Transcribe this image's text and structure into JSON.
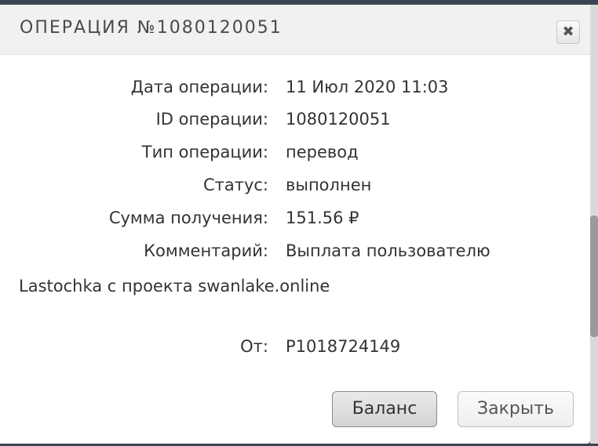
{
  "dialog": {
    "title": "ОПЕРАЦИЯ №1080120051",
    "close_icon": "✖"
  },
  "details": {
    "date_label": "Дата операции:",
    "date_value": "11 Июл 2020 11:03",
    "id_label": "ID операции:",
    "id_value": "1080120051",
    "type_label": "Тип операции:",
    "type_value": "перевод",
    "status_label": "Статус:",
    "status_value": "выполнен",
    "amount_label": "Сумма получения:",
    "amount_value": "151.56 ₽",
    "comment_label": "Комментарий:",
    "comment_value_line1": "Выплата пользователю",
    "comment_value_line2": "Lastochka с проекта swanlake.online",
    "from_label": "От:",
    "from_value": "P1018724149"
  },
  "buttons": {
    "balance_label": "Баланс",
    "close_label": "Закрыть"
  }
}
